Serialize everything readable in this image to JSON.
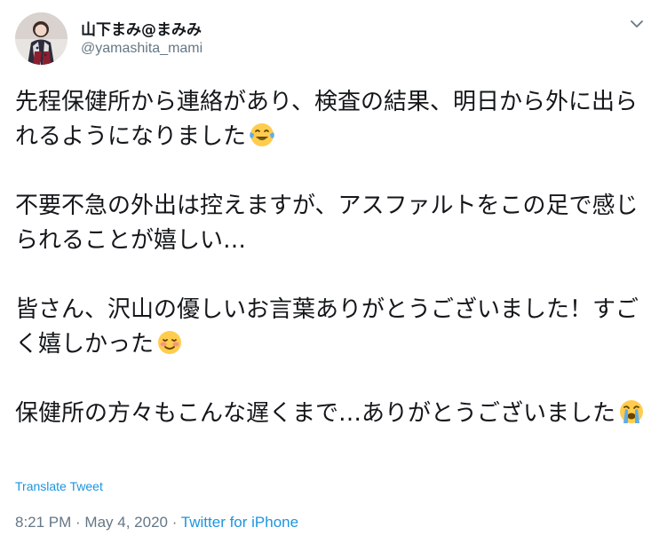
{
  "user": {
    "display_name": "山下まみ@まみみ",
    "handle": "@yamashita_mami"
  },
  "icons": {
    "more": "chevron-down-icon",
    "emoji_1": "face-with-tears-of-joy",
    "emoji_2": "smiling-face",
    "emoji_3": "loudly-crying-face"
  },
  "tweet": {
    "paragraphs": [
      "先程保健所から連絡があり、検査の結果、明日から外に出られるようになりました",
      "不要不急の外出は控えますが、アスファルトをこの足で感じられることが嬉しい…",
      "皆さん、沢山の優しいお言葉ありがとうございました！すごく嬉しかった",
      "保健所の方々もこんな遅くまで…ありがとうございました"
    ]
  },
  "actions": {
    "translate": "Translate Tweet"
  },
  "meta": {
    "time": "8:21 PM",
    "separator_1": " · ",
    "date": "May 4, 2020",
    "separator_2": " · ",
    "source": "Twitter for iPhone"
  },
  "colors": {
    "text": "#14171a",
    "secondary": "#657786",
    "link": "#1b95e0"
  }
}
